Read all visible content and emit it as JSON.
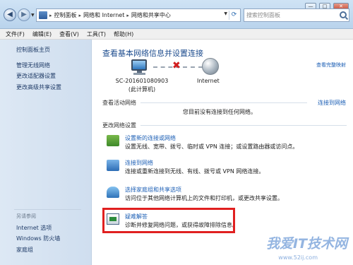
{
  "window": {
    "buttons": {
      "minimize": "—",
      "maximize": "□",
      "close": "✕"
    }
  },
  "address": {
    "segments": [
      "控制面板",
      "网络和 Internet",
      "网络和共享中心"
    ],
    "separator": "▸"
  },
  "search": {
    "placeholder": "搜索控制面板"
  },
  "menu": {
    "items": [
      "文件(F)",
      "编辑(E)",
      "查看(V)",
      "工具(T)",
      "帮助(H)"
    ]
  },
  "sidebar": {
    "home": "控制面板主页",
    "items": [
      "管理无线网络",
      "更改适配器设置",
      "更改高级共享设置"
    ],
    "see_also_title": "另请参阅",
    "see_also": [
      "Internet 选项",
      "Windows 防火墙",
      "家庭组"
    ]
  },
  "main": {
    "title": "查看基本网络信息并设置连接",
    "full_map": "查看完整映射",
    "computer_name": "SC-201601080903",
    "computer_sub": "(此计算机)",
    "internet_label": "Internet",
    "active_section": "查看活动网络",
    "connect_link": "连接到网络",
    "active_msg": "您目前没有连接到任何网络。",
    "change_section": "更改网络设置",
    "tasks": [
      {
        "title": "设置新的连接或网络",
        "desc": "设置无线、宽带、拨号、临时或 VPN 连接；或设置路由器或访问点。",
        "desc2": "",
        "icon": "network-setup-icon"
      },
      {
        "title": "连接到网络",
        "desc": "连接或重新连接到无线、有线、拨号或 VPN 网络连接。",
        "desc2": "",
        "icon": "connect-network-icon"
      },
      {
        "title": "选择家庭组和共享选项",
        "desc": "访问位于其他网络计算机上的文件和打印机，或更改共享设置。",
        "desc2": "",
        "icon": "homegroup-icon"
      },
      {
        "title": "疑难解答",
        "desc": "诊断并修复网络问题，或获得故障排除信息。",
        "desc2": "",
        "icon": "troubleshoot-icon"
      }
    ]
  },
  "watermark": {
    "text": "我爱IT技术网",
    "url": "www.52ij.com"
  },
  "colors": {
    "link": "#1c5fb5",
    "title": "#1d4c8e",
    "highlight": "#e02020"
  }
}
